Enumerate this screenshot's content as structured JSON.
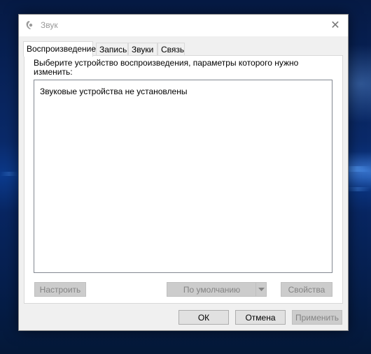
{
  "window": {
    "title": "Звук",
    "close_symbol": "✕",
    "app_icon": "speaker-icon"
  },
  "tabs": [
    {
      "label": "Воспроизведение",
      "active": true
    },
    {
      "label": "Запись",
      "active": false
    },
    {
      "label": "Звуки",
      "active": false
    },
    {
      "label": "Связь",
      "active": false
    }
  ],
  "playback": {
    "instruction": "Выберите устройство воспроизведения, параметры которого нужно изменить:",
    "empty_message": "Звуковые устройства не установлены",
    "configure_label": "Настроить",
    "default_label": "По умолчанию",
    "properties_label": "Свойства"
  },
  "footer": {
    "ok_label": "ОК",
    "cancel_label": "Отмена",
    "apply_label": "Применить"
  },
  "colors": {
    "desktop_accent": "#0c3a8c",
    "window_bg": "#f0f0f0",
    "disabled_text": "#838383"
  }
}
